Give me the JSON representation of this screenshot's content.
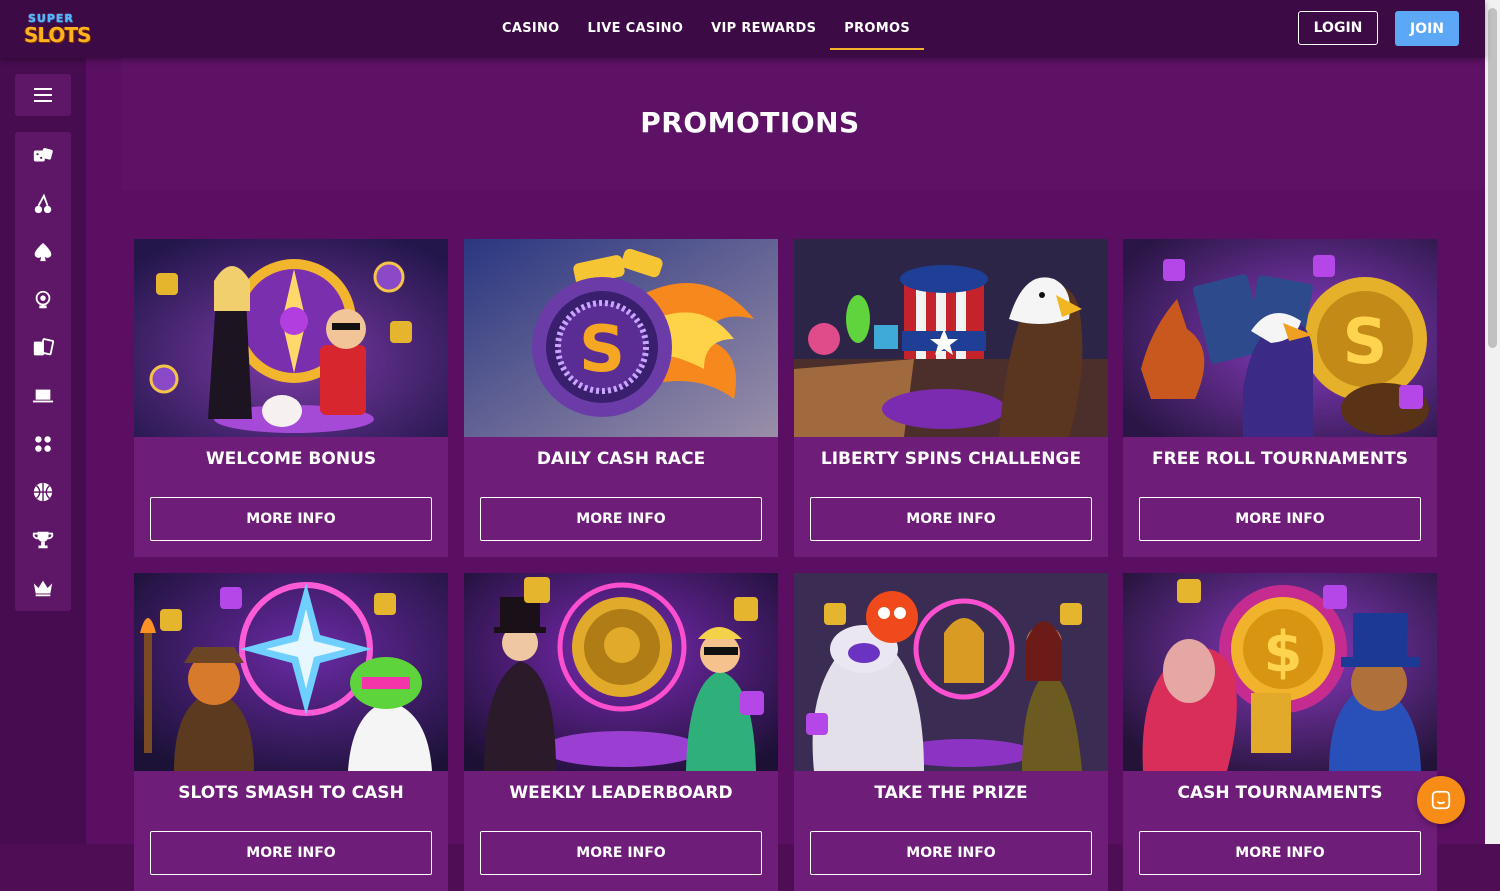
{
  "header": {
    "logo_top": "SUPER",
    "logo_bottom": "SLOTS",
    "nav": [
      {
        "label": "CASINO"
      },
      {
        "label": "LIVE CASINO"
      },
      {
        "label": "VIP REWARDS"
      },
      {
        "label": "PROMOS",
        "active": true
      }
    ],
    "login_label": "LOGIN",
    "join_label": "JOIN"
  },
  "sidebar": {
    "menu_icon": "hamburger-icon",
    "icons": [
      "dice-icon",
      "cherry-icon",
      "spade-icon",
      "dealer-icon",
      "cards-icon",
      "laptop-icon",
      "dots-icon",
      "basketball-icon",
      "trophy-icon",
      "crown-icon"
    ]
  },
  "page": {
    "title": "PROMOTIONS"
  },
  "promos": [
    {
      "title": "WELCOME BONUS",
      "button": "MORE INFO"
    },
    {
      "title": "DAILY CASH RACE",
      "button": "MORE INFO"
    },
    {
      "title": "LIBERTY SPINS CHALLENGE",
      "button": "MORE INFO"
    },
    {
      "title": "FREE ROLL TOURNAMENTS",
      "button": "MORE INFO"
    },
    {
      "title": "SLOTS SMASH TO CASH",
      "button": "MORE INFO"
    },
    {
      "title": "WEEKLY LEADERBOARD",
      "button": "MORE INFO"
    },
    {
      "title": "TAKE THE PRIZE",
      "button": "MORE INFO"
    },
    {
      "title": "CASH TOURNAMENTS",
      "button": "MORE INFO"
    }
  ],
  "colors": {
    "accent": "#f5b12a",
    "join": "#5da7f7",
    "chat": "#f78c17",
    "card": "#6e1d79"
  },
  "chat_icon": "chat-icon"
}
